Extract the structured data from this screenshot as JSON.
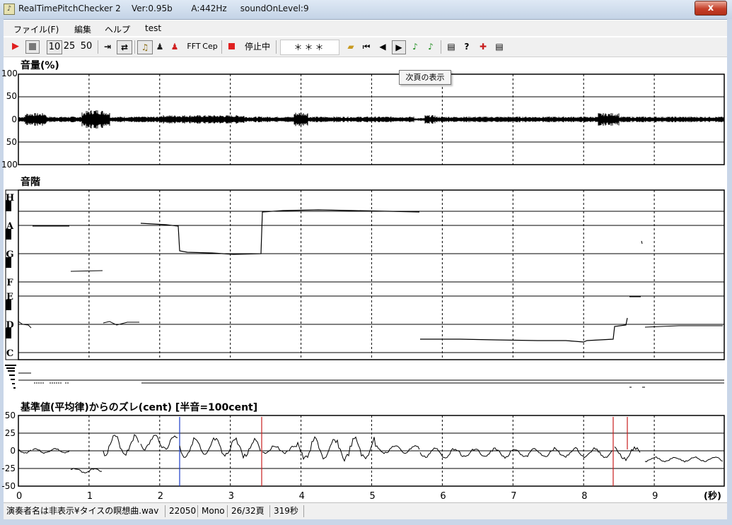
{
  "window": {
    "title": "RealTimePitchChecker 2    Ver:0.95b       A:442Hz     soundOnLevel:9",
    "close_label": "x"
  },
  "menu": [
    "ファイル(F)",
    "編集",
    "ヘルプ",
    "test"
  ],
  "toolbar": {
    "speed_10": "10",
    "speed_25": "25",
    "speed_50": "50",
    "fft_label": "FFT",
    "cep_label": "Cep",
    "state_label": "停止中",
    "display_text": "＊＊＊"
  },
  "tooltip": "次頁の表示",
  "volume_panel": {
    "title": "音量(%)",
    "y_labels": [
      "100",
      "50",
      "0",
      "50",
      "100"
    ]
  },
  "scale_panel": {
    "title": "音階",
    "note_labels": [
      "H",
      "A",
      "G",
      "F",
      "E",
      "D",
      "C"
    ]
  },
  "deviation_panel": {
    "title": "基準値(平均律)からのズレ(cent) [半音=100cent]",
    "y_labels": [
      "50",
      "25",
      "0",
      "-25",
      "-50"
    ]
  },
  "x_axis": {
    "ticks": [
      "0",
      "1",
      "2",
      "3",
      "4",
      "5",
      "6",
      "7",
      "8",
      "9"
    ],
    "unit": "(秒)"
  },
  "statusbar": {
    "filename": "演奏者名は非表示¥タイスの瞑想曲.wav",
    "sample_rate": "22050",
    "channel": "Mono",
    "page": "26/32頁",
    "duration": "319秒"
  },
  "colors": {
    "play": "#e02020",
    "blue_marker": "#1a3cc8",
    "red_marker": "#c81e1e"
  },
  "icons": {
    "play": "play-icon",
    "stop": "stop-icon",
    "step": "step-icon",
    "loop": "loop-icon",
    "violin": "violin-icon",
    "person": "person-icon",
    "person_red": "singer-icon",
    "record": "record-icon",
    "open": "folder-open-icon",
    "first": "first-page-icon",
    "prev": "prev-page-icon",
    "next": "next-page-icon",
    "note1": "note-icon",
    "note2": "note2-icon",
    "print": "print-icon",
    "help": "help-icon",
    "marker": "marker-icon",
    "printer2": "printer-icon"
  }
}
